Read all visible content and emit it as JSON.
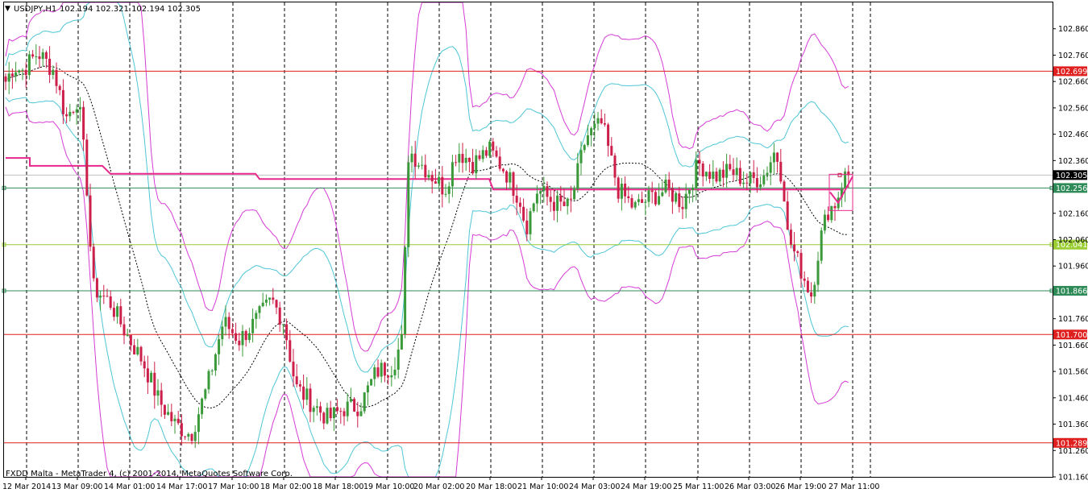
{
  "header": {
    "symbol_label": "USDJPY,H1",
    "ohlc": "102.194 102.321 102.194 102.305"
  },
  "footer": {
    "copyright": "FXDD Malta - MetaTrader 4, (c) 2001-2014, MetaQuotes Software Corp."
  },
  "colors": {
    "background": "#ffffff",
    "bull_candle": "#3a9a3a",
    "bear_candle": "#cc1f4a",
    "outer_band": "#d63cd6",
    "inner_band": "#4ec6d6",
    "mid_line": "#000000",
    "support_resistance_red": "#e01f1f",
    "support_green": "#2e8b57",
    "level_lime": "#9acd32",
    "pivot_line": "#e8288c",
    "current_price_line": "#c0c0c0"
  },
  "chart_data": {
    "type": "candlestick",
    "instrument": "USDJPY",
    "timeframe": "H1",
    "ylim": [
      101.16,
      102.96
    ],
    "y_ticks": [
      102.86,
      102.76,
      102.66,
      102.56,
      102.46,
      102.36,
      102.16,
      102.06,
      101.96,
      101.76,
      101.66,
      101.56,
      101.46,
      101.36,
      101.26,
      101.16
    ],
    "y_tick_labels": [
      "102.860",
      "102.760",
      "102.660",
      "102.560",
      "102.460",
      "102.360",
      "102.160",
      "102.060",
      "101.960",
      "101.760",
      "101.660",
      "101.560",
      "101.460",
      "101.360",
      "101.260",
      "101.160"
    ],
    "x_tick_labels": [
      "12 Mar 2014",
      "13 Mar 09:00",
      "14 Mar 01:00",
      "14 Mar 17:00",
      "17 Mar 10:00",
      "18 Mar 02:00",
      "18 Mar 18:00",
      "19 Mar 10:00",
      "20 Mar 02:00",
      "20 Mar 18:00",
      "21 Mar 10:00",
      "24 Mar 03:00",
      "24 Mar 19:00",
      "25 Mar 11:00",
      "26 Mar 03:00",
      "26 Mar 19:00",
      "27 Mar 11:00"
    ],
    "grid": "vertical-dashed",
    "horizontal_levels": [
      {
        "price": 102.699,
        "label": "102.699",
        "color": "red"
      },
      {
        "price": 102.305,
        "label": "102.305",
        "color": "current"
      },
      {
        "price": 102.256,
        "label": "102.256",
        "color": "green"
      },
      {
        "price": 102.041,
        "label": "102.041",
        "color": "lime"
      },
      {
        "price": 101.866,
        "label": "101.866",
        "color": "green"
      },
      {
        "price": 101.7,
        "label": "101.700",
        "color": "red"
      },
      {
        "price": 101.289,
        "label": "101.289",
        "color": "red"
      }
    ],
    "pivot_line": [
      [
        0,
        102.37
      ],
      [
        30,
        102.37
      ],
      [
        30,
        102.34
      ],
      [
        120,
        102.34
      ],
      [
        130,
        102.31
      ],
      [
        310,
        102.31
      ],
      [
        315,
        102.29
      ],
      [
        600,
        102.29
      ],
      [
        605,
        102.25
      ],
      [
        1040,
        102.25
      ]
    ],
    "anchors": [
      [
        0,
        102.66
      ],
      [
        10,
        102.72
      ],
      [
        20,
        102.7
      ],
      [
        40,
        102.77
      ],
      [
        60,
        102.7
      ],
      [
        75,
        102.52
      ],
      [
        90,
        102.6
      ],
      [
        100,
        102.3
      ],
      [
        108,
        101.88
      ],
      [
        130,
        101.82
      ],
      [
        150,
        101.7
      ],
      [
        170,
        101.6
      ],
      [
        190,
        101.45
      ],
      [
        210,
        101.36
      ],
      [
        230,
        101.32
      ],
      [
        250,
        101.5
      ],
      [
        270,
        101.75
      ],
      [
        290,
        101.68
      ],
      [
        310,
        101.75
      ],
      [
        330,
        101.83
      ],
      [
        345,
        101.75
      ],
      [
        360,
        101.5
      ],
      [
        380,
        101.44
      ],
      [
        400,
        101.38
      ],
      [
        420,
        101.42
      ],
      [
        440,
        101.43
      ],
      [
        460,
        101.56
      ],
      [
        480,
        101.58
      ],
      [
        492,
        101.68
      ],
      [
        500,
        102.4
      ],
      [
        515,
        102.35
      ],
      [
        530,
        102.3
      ],
      [
        545,
        102.25
      ],
      [
        560,
        102.4
      ],
      [
        580,
        102.35
      ],
      [
        600,
        102.4
      ],
      [
        620,
        102.32
      ],
      [
        640,
        102.2
      ],
      [
        645,
        102.1
      ],
      [
        660,
        102.25
      ],
      [
        680,
        102.2
      ],
      [
        700,
        102.18
      ],
      [
        720,
        102.45
      ],
      [
        740,
        102.5
      ],
      [
        760,
        102.25
      ],
      [
        780,
        102.18
      ],
      [
        800,
        102.22
      ],
      [
        820,
        102.25
      ],
      [
        840,
        102.2
      ],
      [
        860,
        102.35
      ],
      [
        880,
        102.3
      ],
      [
        900,
        102.32
      ],
      [
        920,
        102.28
      ],
      [
        940,
        102.3
      ],
      [
        955,
        102.4
      ],
      [
        965,
        102.28
      ],
      [
        970,
        102.08
      ],
      [
        980,
        102.0
      ],
      [
        990,
        101.92
      ],
      [
        1000,
        101.85
      ],
      [
        1010,
        102.05
      ],
      [
        1020,
        102.17
      ],
      [
        1030,
        102.2
      ],
      [
        1040,
        102.3
      ]
    ]
  }
}
